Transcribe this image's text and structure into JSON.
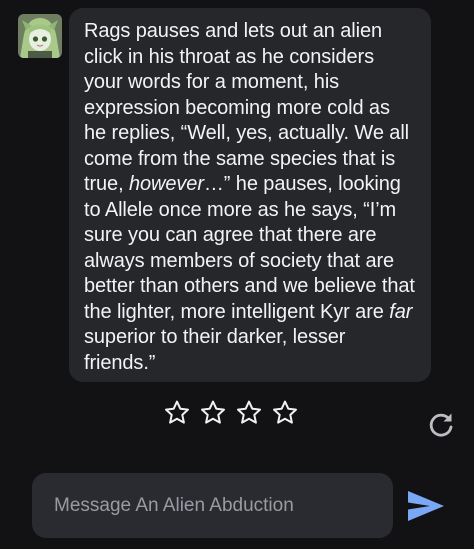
{
  "message": {
    "avatar_icon": "character-avatar",
    "segments": [
      {
        "text": "Rags pauses and lets out an alien click in his throat as he considers your words for a moment, his expression becoming more cold as he replies, “Well, yes, actually. We all come from the same species that is true, ",
        "italic": false
      },
      {
        "text": "however",
        "italic": true
      },
      {
        "text": "…” he pauses, looking to Allele once more as he says, “I’m sure you can agree that there are always members of society that are better than others and we believe that the lighter, more intelligent Kyr are ",
        "italic": false
      },
      {
        "text": "far",
        "italic": true
      },
      {
        "text": " superior to their darker, lesser friends.”",
        "italic": false
      }
    ]
  },
  "rating": {
    "stars": 4,
    "selected": 0,
    "icon": "star-outline-icon"
  },
  "regenerate": {
    "icon": "refresh-icon"
  },
  "composer": {
    "placeholder": "Message An Alien Abduction",
    "value": "",
    "send_icon": "send-icon"
  },
  "colors": {
    "background": "#121214",
    "bubble": "#26272b",
    "input": "#2a2b30",
    "accent": "#7aa8f5"
  }
}
